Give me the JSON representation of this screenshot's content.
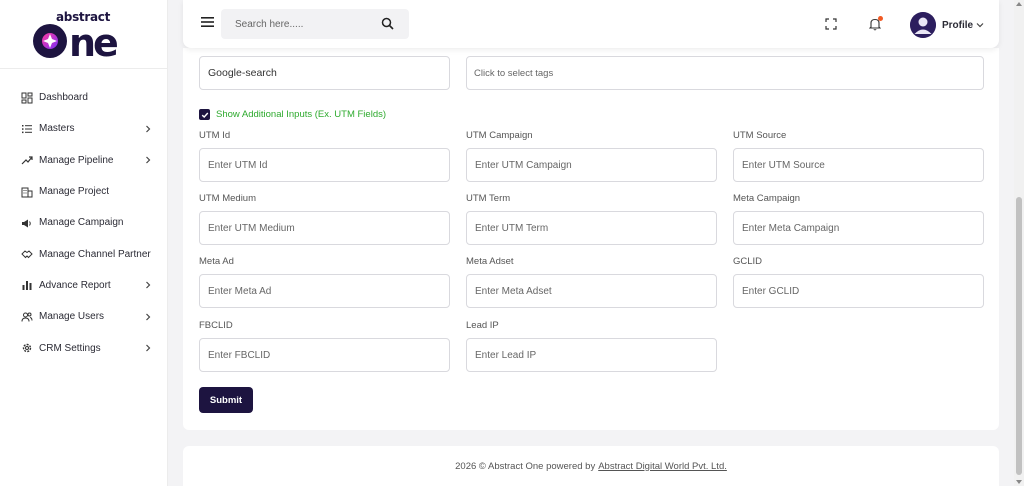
{
  "logo": {
    "line1": "abstract",
    "line2": "ONe"
  },
  "sidebar": {
    "items": [
      {
        "label": "Dashboard",
        "icon": "dashboard-icon",
        "has_submenu": false
      },
      {
        "label": "Masters",
        "icon": "list-icon",
        "has_submenu": true
      },
      {
        "label": "Manage Pipeline",
        "icon": "pipeline-icon",
        "has_submenu": true
      },
      {
        "label": "Manage Project",
        "icon": "building-icon",
        "has_submenu": false
      },
      {
        "label": "Manage Campaign",
        "icon": "megaphone-icon",
        "has_submenu": false
      },
      {
        "label": "Manage Channel Partner",
        "icon": "handshake-icon",
        "has_submenu": false
      },
      {
        "label": "Advance Report",
        "icon": "bar-chart-icon",
        "has_submenu": true
      },
      {
        "label": "Manage Users",
        "icon": "users-icon",
        "has_submenu": true
      },
      {
        "label": "CRM Settings",
        "icon": "gear-icon",
        "has_submenu": true
      }
    ]
  },
  "header": {
    "search_placeholder": "Search here.....",
    "profile_label": "Profile"
  },
  "form": {
    "source_value": "Google-search",
    "tags_placeholder": "Click to select tags",
    "checkbox_label": "Show Additional Inputs (Ex. UTM Fields)",
    "checkbox_checked": true,
    "fields": [
      {
        "label": "UTM Id",
        "placeholder": "Enter UTM Id"
      },
      {
        "label": "UTM Campaign",
        "placeholder": "Enter UTM Campaign"
      },
      {
        "label": "UTM Source",
        "placeholder": "Enter UTM Source"
      },
      {
        "label": "UTM Medium",
        "placeholder": "Enter UTM Medium"
      },
      {
        "label": "UTM Term",
        "placeholder": "Enter UTM Term"
      },
      {
        "label": "Meta Campaign",
        "placeholder": "Enter Meta Campaign"
      },
      {
        "label": "Meta Ad",
        "placeholder": "Enter Meta Ad"
      },
      {
        "label": "Meta Adset",
        "placeholder": "Enter Meta Adset"
      },
      {
        "label": "GCLID",
        "placeholder": "Enter GCLID"
      },
      {
        "label": "FBCLID",
        "placeholder": "Enter FBCLID"
      },
      {
        "label": "Lead IP",
        "placeholder": "Enter Lead IP"
      }
    ],
    "submit_label": "Submit"
  },
  "footer": {
    "text": "2026 © Abstract One powered by",
    "link_text": "Abstract Digital World Pvt. Ltd."
  },
  "colors": {
    "brand": "#1d1440",
    "accent_green": "#2eaa2e",
    "notification_dot": "#f15a24",
    "logo_gradient_a": "#ff3aa0",
    "logo_gradient_b": "#7b2ff7"
  }
}
